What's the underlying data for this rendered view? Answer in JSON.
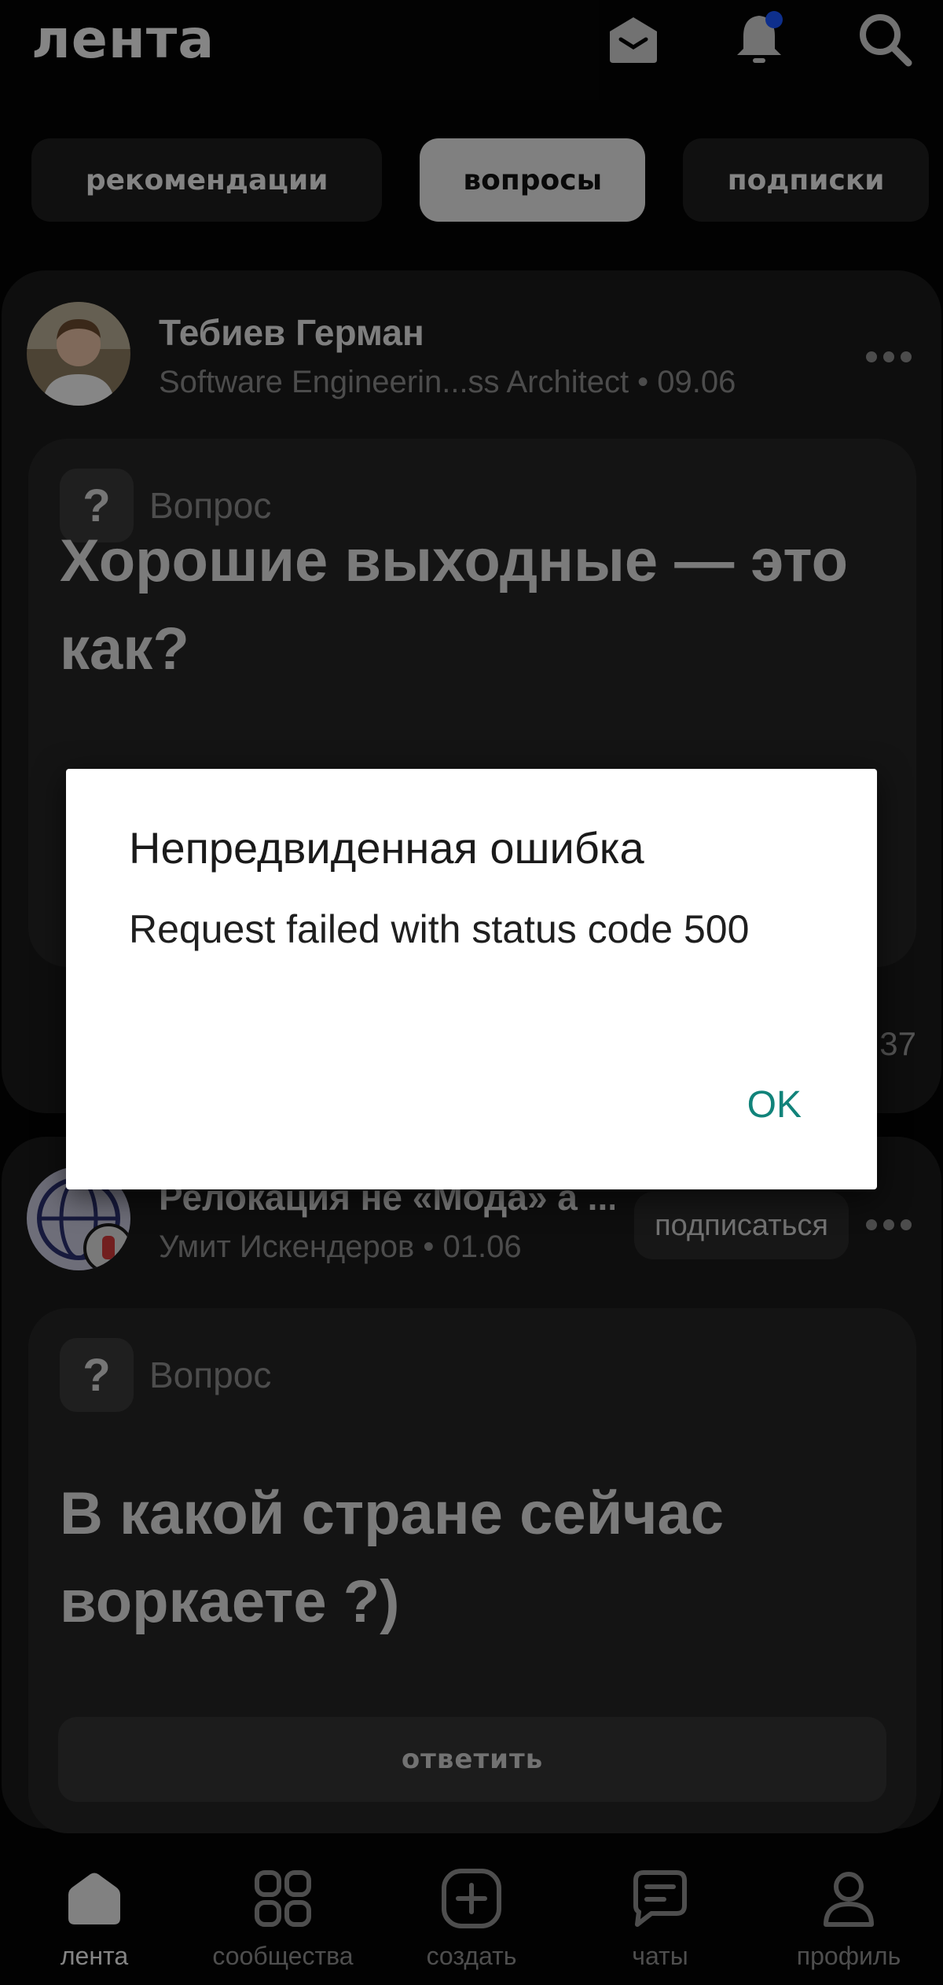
{
  "header": {
    "brand": "лента",
    "icons": [
      "mail-icon",
      "bell-icon",
      "search-icon"
    ],
    "notification_dot_color": "#1a56ff"
  },
  "tabs": [
    {
      "label": "рекомендации",
      "active": false
    },
    {
      "label": "вопросы",
      "active": true
    },
    {
      "label": "подписки",
      "active": false
    }
  ],
  "feed": {
    "post1": {
      "author": "Тебиев Герман",
      "meta": "Software Engineerin...ss Architect • 09.06",
      "question_label": "Вопрос",
      "question_title": "Хорошие выходные — это как?",
      "stat_fragment": "37"
    },
    "post2": {
      "author": "Релокация не «Мода» а ...",
      "meta": "Умит Искендеров • 01.06",
      "subscribe_label": "подписаться",
      "question_label": "Вопрос",
      "question_title": "В какой стране сейчас воркаете ?)",
      "answer_label": "ответить"
    }
  },
  "bottom_nav": [
    {
      "label": "лента",
      "icon": "home-icon",
      "active": true
    },
    {
      "label": "сообщества",
      "icon": "grid-icon",
      "active": false
    },
    {
      "label": "создать",
      "icon": "plus-square-icon",
      "active": false
    },
    {
      "label": "чаты",
      "icon": "chat-icon",
      "active": false
    },
    {
      "label": "профиль",
      "icon": "profile-icon",
      "active": false
    }
  ],
  "dialog": {
    "title": "Непредвиденная ошибка",
    "message": "Request failed with status code 500",
    "ok_label": "OK",
    "accent_color": "#11837a"
  }
}
